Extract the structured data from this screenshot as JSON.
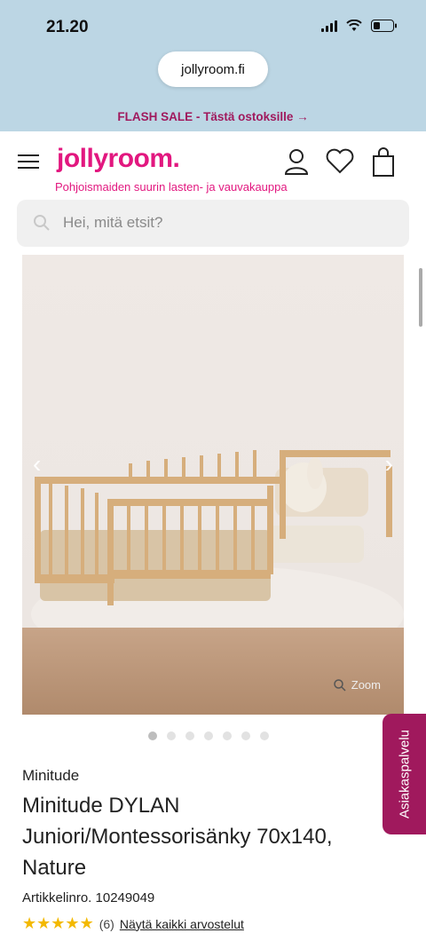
{
  "status_bar": {
    "time": "21.20"
  },
  "browser": {
    "url": "jollyroom.fi"
  },
  "promo": {
    "text": "FLASH SALE - Tästä ostoksille →"
  },
  "header": {
    "logo": "jollyroom.",
    "tagline": "Pohjoismaiden suurin lasten- ja vauvakauppa"
  },
  "search": {
    "placeholder": "Hei, mitä etsit?"
  },
  "gallery": {
    "zoom_label": "Zoom",
    "image_count": 7,
    "active_index": 0
  },
  "product": {
    "brand": "Minitude",
    "title": "Minitude DYLAN Juniori/Montessorisänky 70x140, Nature",
    "article_label": "Artikkelinro.",
    "article_number": "10249049",
    "rating_count": "(6)",
    "reviews_link": "Näytä kaikki arvostelut"
  },
  "customer_service": {
    "label": "Asiakaspalvelu"
  },
  "colors": {
    "brand_pink": "#e2177f",
    "promo_purple": "#a0195d",
    "status_bg": "#bcd6e4"
  }
}
